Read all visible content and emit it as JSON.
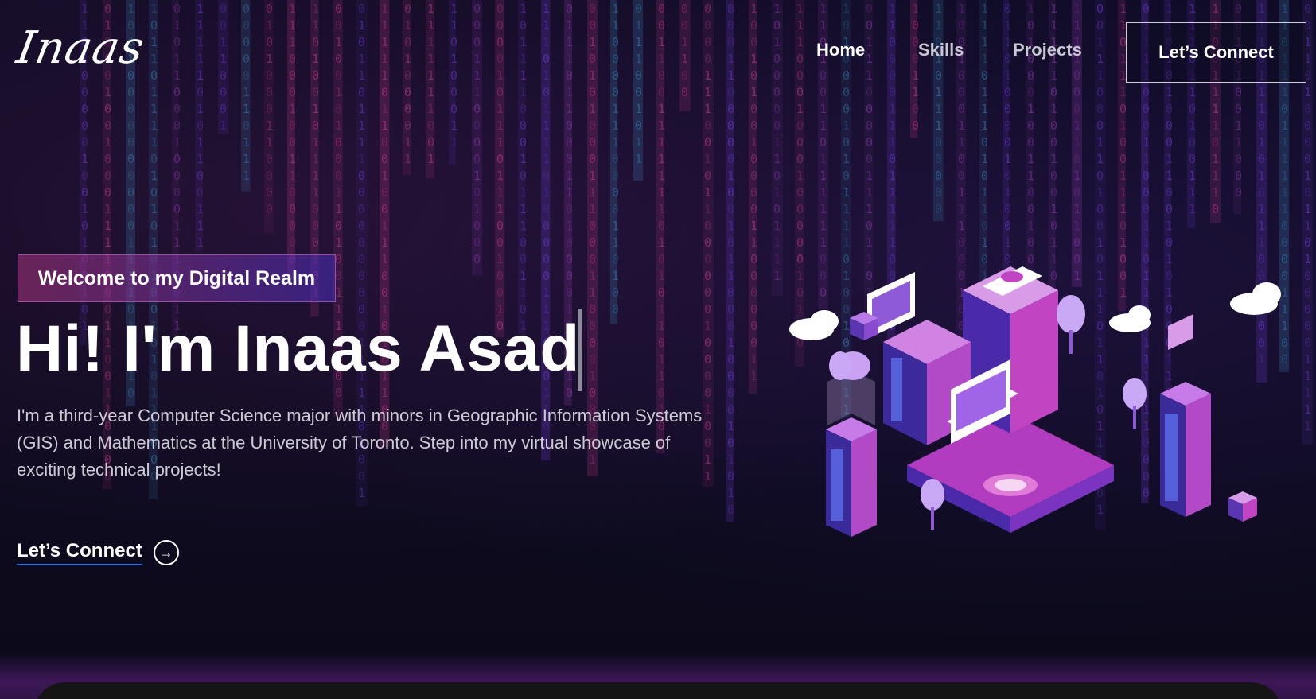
{
  "nav": {
    "logo": "Inaas",
    "links": [
      {
        "label": "Home",
        "active": true
      },
      {
        "label": "Skills",
        "active": false
      },
      {
        "label": "Projects",
        "active": false
      }
    ],
    "connect_label": "Let’s Connect"
  },
  "hero": {
    "tagline": "Welcome to my Digital Realm",
    "headline": "Hi! I'm Inaas Asad",
    "bio": "I'm a third-year Computer Science major with minors in Geographic Information Systems (GIS) and Mathematics at the University of Toronto. Step into my virtual showcase of exciting technical projects!",
    "cta_label": "Let’s Connect"
  },
  "colors": {
    "background": "#0b0a1c",
    "accent_pink": "#c13b8a",
    "accent_purple": "#6c3bd1",
    "link_underline": "#2b6fd8"
  },
  "icons": {
    "cta_icon": "arrow-circle-right-icon"
  }
}
